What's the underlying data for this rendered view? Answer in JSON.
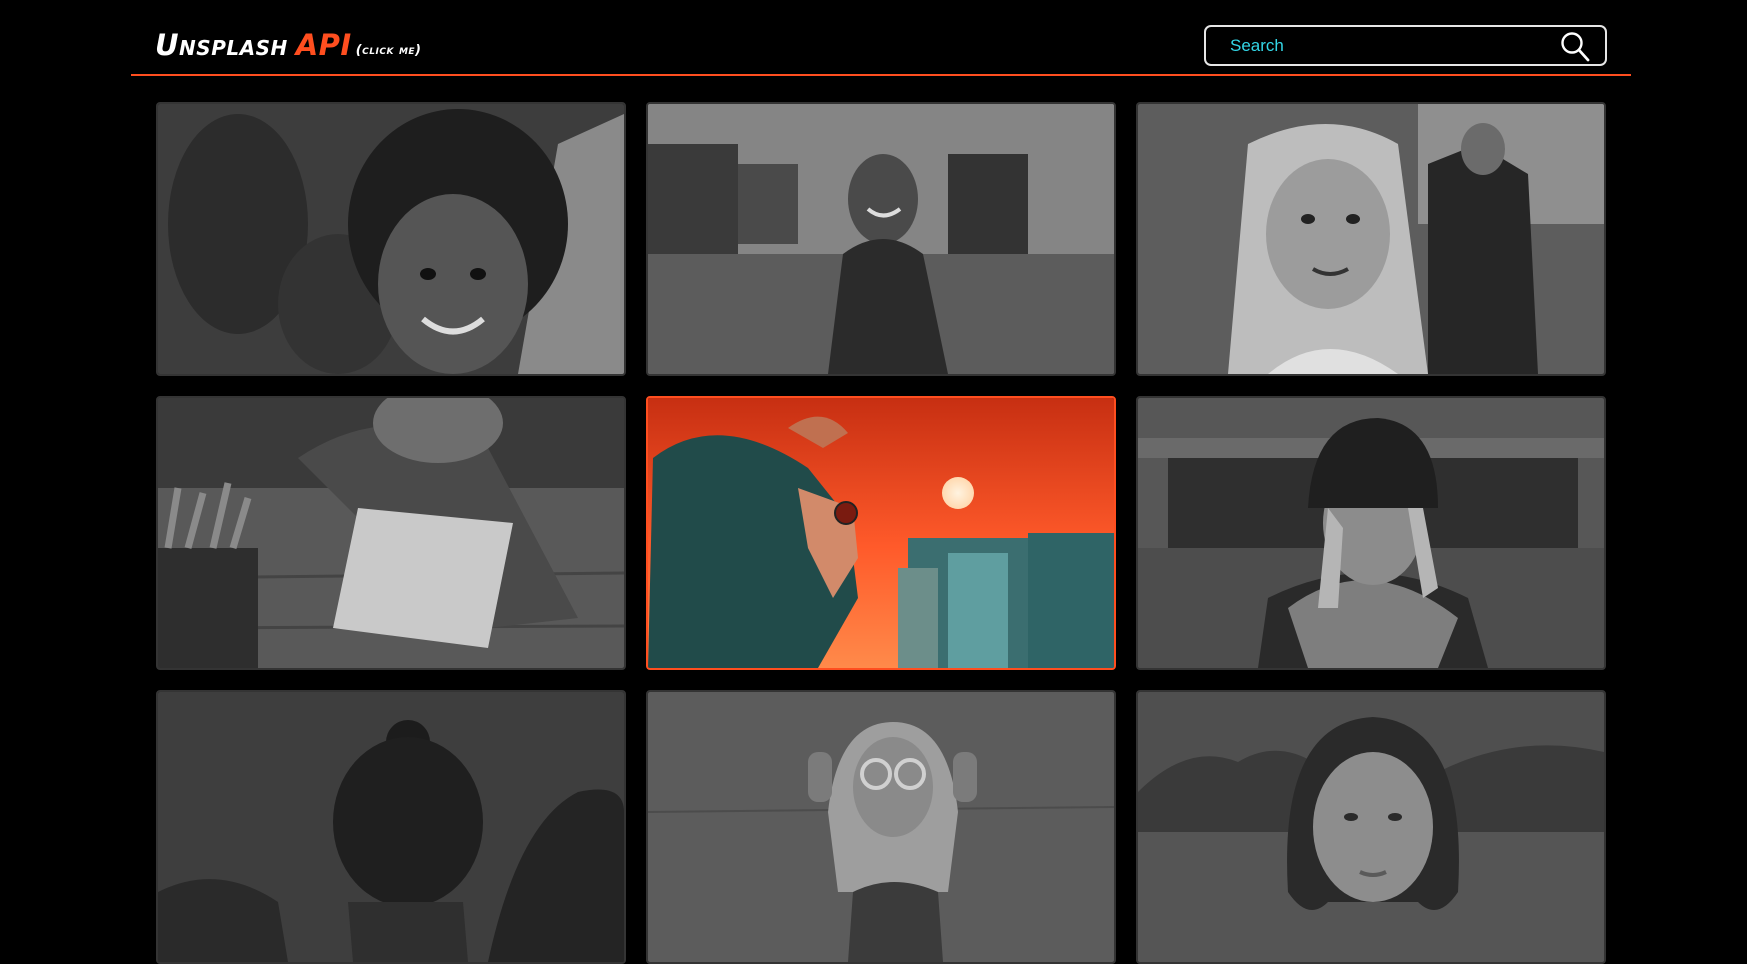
{
  "header": {
    "logo_word1": "Unsplash",
    "logo_word2": "API",
    "logo_hint": "(click me)",
    "search_placeholder": "Search",
    "search_icon": "search-icon"
  },
  "colors": {
    "accent": "#ff4e1f",
    "background": "#000000",
    "search_text": "#33d6e6"
  },
  "gallery": {
    "images": [
      {
        "subject": "smiling child with curly hair",
        "state": "grayscale"
      },
      {
        "subject": "smiling girl with backpack on street",
        "state": "grayscale"
      },
      {
        "subject": "girl with glitter makeup at festival",
        "state": "grayscale"
      },
      {
        "subject": "child drawing at wooden table",
        "state": "grayscale"
      },
      {
        "subject": "woman with sunglasses at sunset",
        "state": "color-hovered"
      },
      {
        "subject": "woman in beanie and scarf",
        "state": "grayscale"
      },
      {
        "subject": "woman from behind with hair bun",
        "state": "grayscale"
      },
      {
        "subject": "woman holding round sunglasses",
        "state": "grayscale"
      },
      {
        "subject": "woman with bob haircut portrait",
        "state": "grayscale"
      }
    ]
  }
}
